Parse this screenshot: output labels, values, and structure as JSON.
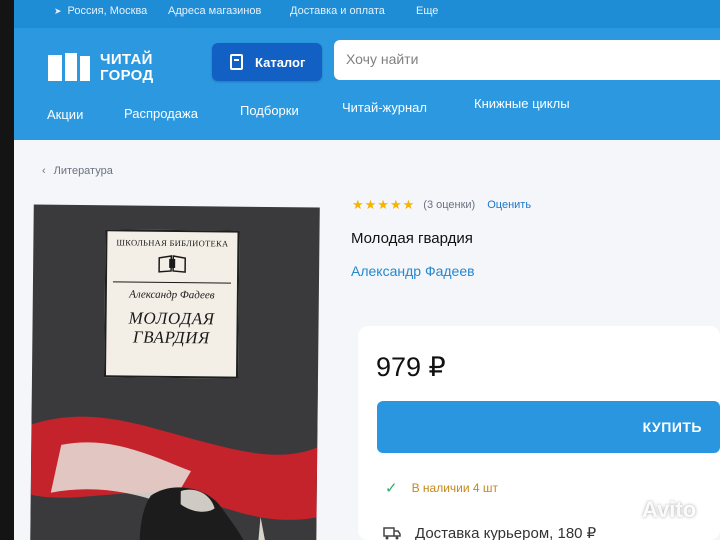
{
  "topbar": {
    "location": "Россия, Москва",
    "stores": "Адреса магазинов",
    "delivery": "Доставка и оплата",
    "more": "Еще"
  },
  "header": {
    "logo_line1": "ЧИТАЙ",
    "logo_line2": "ГОРОД",
    "catalog_label": "Каталог",
    "search_placeholder": "Хочу найти"
  },
  "nav": {
    "items": [
      "Акции",
      "Распродажа",
      "Подборки",
      "Читай-журнал",
      "Книжные циклы"
    ]
  },
  "breadcrumb": {
    "label": "Литература"
  },
  "cover": {
    "series": "ШКОЛЬНАЯ БИБЛИОТЕКА",
    "author": "Александр Фадеев",
    "title_line1": "МОЛОДАЯ",
    "title_line2": "ГВАРДИЯ"
  },
  "product": {
    "stars": "★★★★★",
    "rating_count": "(3 оценки)",
    "rate_label": "Оценить",
    "title": "Молодая гвардия",
    "author": "Александр Фадеев",
    "price": "979 ₽",
    "buy_label": "КУПИТЬ",
    "stock": "В наличии 4 шт",
    "delivery": "Доставка курьером, 180 ₽"
  },
  "watermark": "Avito",
  "colors": {
    "brand_blue": "#2b98e0",
    "catalog_button": "#1260c4",
    "link_blue": "#2488d0",
    "star_yellow": "#f4b400",
    "stock_orange": "#c8871a",
    "check_green": "#2faa6b"
  }
}
